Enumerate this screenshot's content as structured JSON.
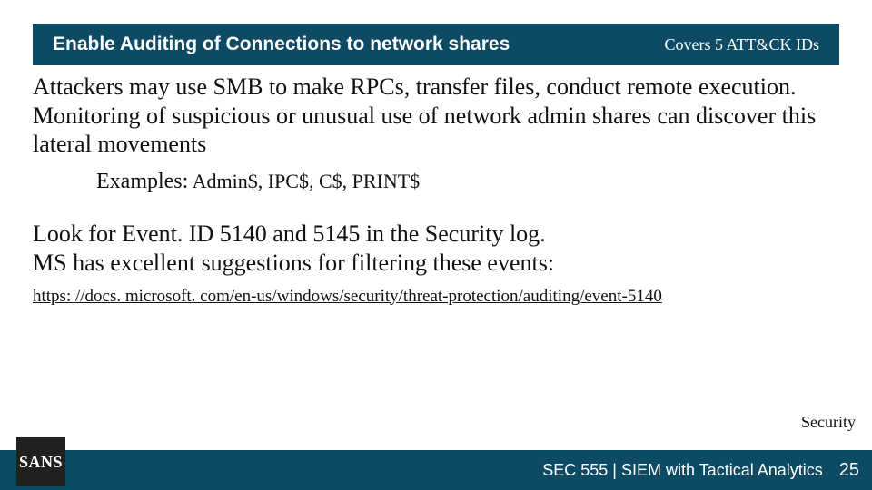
{
  "header": {
    "title": "Enable Auditing of Connections to network shares",
    "badge": "Covers 5 ATT&CK IDs"
  },
  "body": {
    "para1": "Attackers may use SMB to make RPCs, transfer files, conduct remote execution.  Monitoring of suspicious or unusual use of network admin shares can discover this lateral movements",
    "examples_label": "Examples:",
    "examples_items": " Admin$, IPC$, C$, PRINT$",
    "para2a": "Look for Event. ID 5140 and 5145 in the Security log.",
    "para2b": "MS has excellent suggestions for filtering these events:",
    "link": "https: //docs. microsoft. com/en-us/windows/security/threat-protection/auditing/event-5140"
  },
  "security_tag": "Security",
  "footer": {
    "course": "SEC 555 | SIEM with Tactical Analytics",
    "page": "25"
  },
  "logo": {
    "text": "SANS"
  }
}
